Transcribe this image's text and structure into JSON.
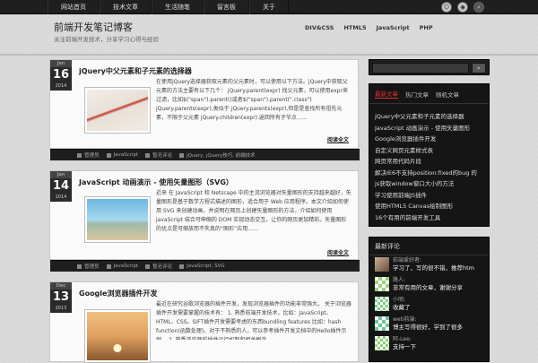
{
  "topnav": [
    "网站首页",
    "技术文章",
    "生活随笔",
    "留言板",
    "关于"
  ],
  "site": {
    "title": "前端开发笔记博客",
    "description": "关注前端开发技术，分享学习心得与经验"
  },
  "mainnav": [
    "DIV&CSS",
    "HTML5",
    "JavaScript",
    "PHP"
  ],
  "posts": [
    {
      "month": "Jan",
      "day": "16",
      "year": "2014",
      "title": "jQuery中父元素和子元素的选择器",
      "excerpt": "在使用jQuery选择器获取元素的父元素时，可以使用以下方法。jQuery中获取父元素的方法主要有以下几个： jQuery.parent(expr) 找父元素，可以使用expr来过滤，比如$(\"span\").parent()或者$(\"span\").parent(\".class\") jQuery.parents(expr),类似于 jQuery.parents(expr),但是是查找所有祖先元素，不限于父元素 jQuery.children(expr).返回所有子节点……",
      "read_more": "阅读全文",
      "meta": [
        "管理员",
        "JavaScript",
        "暂无评论",
        "jQuery, jQuery技巧, 前端技术"
      ],
      "img_colors": [
        "#e8e0d8",
        "#c0392b"
      ]
    },
    {
      "month": "Jan",
      "day": "14",
      "year": "2014",
      "title": "JavaScript 动画演示 - 使用矢量图形（SVG）",
      "excerpt": "近来 在 JavaScript 和 Netscape 中的主流浏览器对矢量图形的支持越来越好，矢量图形是基于数学方程式描述的图形，适合用于 Web 应用程序。本文介绍如何使用 SVG 来创建动画，并说明在网页上创建矢量图形的方法，介绍如何使用javaScript 结合可伸缩的 DOM 实现动态交互，让你的网页更加精彩。矢量图形的优点是可缩放而不失真的“图形”应用……",
      "read_more": "阅读全文",
      "meta": [
        "管理员",
        "JavaScript",
        "暂无评论",
        "JavaScript, SVG"
      ],
      "img_colors": [
        "#7fc8e8",
        "#d9c7a0"
      ]
    },
    {
      "month": "Dec",
      "day": "13",
      "year": "2013",
      "title": "Google浏览器插件开发",
      "excerpt": "最近在研究谷歌浏览器的插件开发，发现浏览器插件的功能非常强大。 关于浏览器插件开发需要掌握的技术有： 1. 熟悉前端开发技术，比如：JavaScript、HTML、CSS。SIFT插件开发需要考虑的东西bundling features 比如：hash function(函数处理)。对于不熟悉的人，可以参考插件开发文档中的Hello插件示例。 2. 熟悉浏览器的插件运行机制和相关概念……",
      "read_more": "阅读全文",
      "meta": [],
      "img_colors": [
        "#e0a060",
        "#8a5a30"
      ]
    }
  ],
  "search": {
    "button": "⌕"
  },
  "sidebar_tabs": [
    "最新文章",
    "热门文章",
    "随机文章"
  ],
  "sidebar_list": [
    "jQuery中父元素和子元素的选择器",
    "JavaScript 动画演示 - 使用矢量图形",
    "Google浏览器插件开发",
    "自定义网页元素样式表",
    "网页常用代码片段",
    "解决IE6不支持position:fixed的bug 的",
    "js获取window窗口大小的方法",
    "学习使用前端JS插件",
    "使用HTML5 Canvas绘制图形",
    "16个有用的前端开发工具"
  ],
  "recent_comments": {
    "title": "最新评论",
    "items": [
      {
        "who": "前端爱好者:",
        "text": "学习了，写的很不错，推荐htm"
      },
      {
        "who": "路人:",
        "text": "非常有用的文章，谢谢分享"
      },
      {
        "who": "小明:",
        "text": "收藏了"
      },
      {
        "who": "web前端:",
        "text": "博主写得很好，学到了很多"
      },
      {
        "who": "阿-Lee:",
        "text": "支持一下"
      }
    ]
  }
}
